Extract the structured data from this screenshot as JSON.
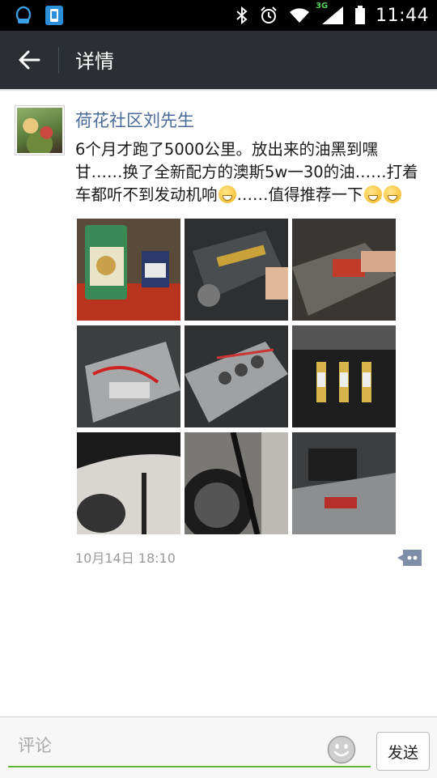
{
  "status_bar": {
    "time": "11:44",
    "network": "3G",
    "icons": [
      "notification-qq-icon",
      "notification-app-icon",
      "bluetooth-icon",
      "alarm-icon",
      "wifi-icon",
      "signal-icon",
      "battery-icon"
    ]
  },
  "header": {
    "back_icon": "back-arrow-icon",
    "title": "详情"
  },
  "post": {
    "author": "荷花社区刘先生",
    "text_part1": "6个月才跑了5000公里。放出来的油黑到嘿甘……换了全新配方的澳斯5w一30的油……打着车都听不到发动机响",
    "text_part2": "……值得推荐一下",
    "emojis": [
      "shush-emoji",
      "grin-emoji",
      "grin-emoji"
    ],
    "photos": [
      "engine-oil-bottle-photo",
      "engine-bay-photo",
      "engine-hand-photo",
      "engine-wires-photo",
      "engine-coils-photo",
      "spark-plugs-photo",
      "car-underside-photo",
      "oil-drain-photo",
      "engine-cover-photo"
    ],
    "timestamp": "10月14日 18:10",
    "comment_icon": "comment-bubble-icon"
  },
  "comment_bar": {
    "placeholder": "评论",
    "emoji_icon": "smiley-icon",
    "send_label": "发送"
  },
  "colors": {
    "title_bar": "#2b2f33",
    "author_link": "#4a6a9a",
    "input_underline": "#5fb336"
  }
}
